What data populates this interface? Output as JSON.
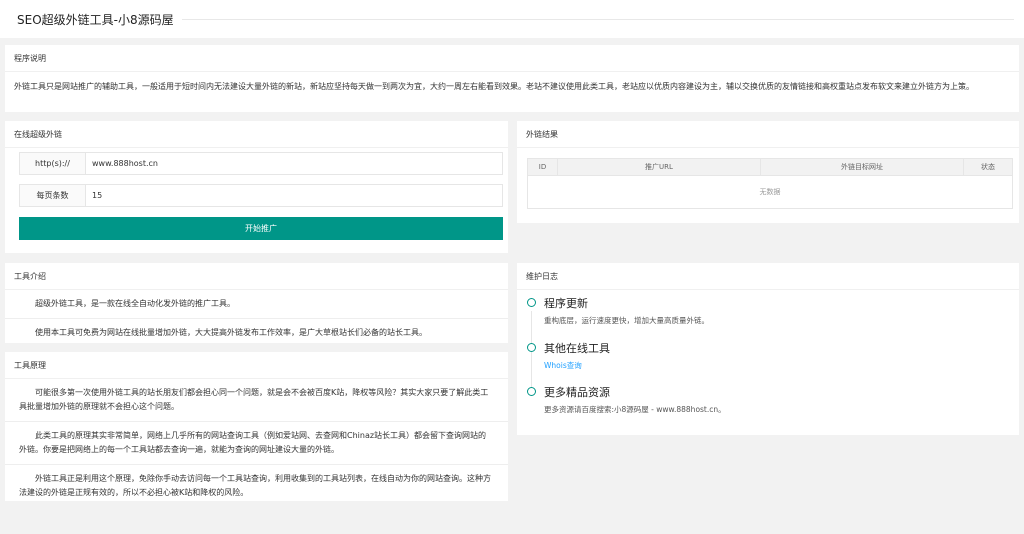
{
  "header": {
    "title": "SEO超级外链工具-小8源码屋"
  },
  "intro": {
    "heading": "程序说明",
    "text": "外链工具只是网站推广的辅助工具，一般适用于短时间内无法建设大量外链的新站，新站应坚持每天做一到两次为宜，大约一周左右能看到效果。老站不建议使用此类工具，老站应以优质内容建设为主，辅以交换优质的友情链接和高权重站点发布软文来建立外链方为上策。"
  },
  "form": {
    "heading": "在线超级外链",
    "url_label": "http(s)://",
    "url_value": "www.888host.cn",
    "count_label": "每页条数",
    "count_value": "15",
    "submit_label": "开始推广"
  },
  "results": {
    "heading": "外链结果",
    "columns": [
      "ID",
      "推广URL",
      "外链目标网址",
      "状态"
    ],
    "empty_text": "无数据"
  },
  "tool_intro": {
    "heading": "工具介绍",
    "paragraphs": [
      "超级外链工具，是一款在线全自动化发外链的推广工具。",
      "使用本工具可免费为网站在线批量增加外链，大大提高外链发布工作效率，是广大草根站长们必备的站长工具。"
    ]
  },
  "principle": {
    "heading": "工具原理",
    "paragraphs": [
      "可能很多第一次使用外链工具的站长朋友们都会担心同一个问题，就是会不会被百度K站，降权等风险？其实大家只要了解此类工具批量增加外链的原理就不会担心这个问题。",
      "此类工具的原理其实非常简单，网络上几乎所有的网站查询工具（例如爱站网、去查网和Chinaz站长工具）都会留下查询网站的外链。你要是把网络上的每一个工具站都去查询一遍，就能为查询的网址建设大量的外链。",
      "外链工具正是利用这个原理，免除你手动去访问每一个工具站查询，利用收集到的工具站列表，在线自动为你的网站查询。这种方法建设的外链是正规有效的，所以不必担心被K站和降权的风险。"
    ]
  },
  "changelog": {
    "heading": "维护日志",
    "items": [
      {
        "title": "程序更新",
        "text": "重构底层，运行速度更快，增加大量高质量外链。"
      },
      {
        "title": "其他在线工具",
        "text": "Whois查询"
      },
      {
        "title": "更多精品资源",
        "text": "更多资源请百度搜索:小8源码屋 - www.888host.cn。"
      }
    ]
  },
  "colors": {
    "accent": "#009688",
    "link": "#1e9fff",
    "background": "#f2f2f2"
  }
}
